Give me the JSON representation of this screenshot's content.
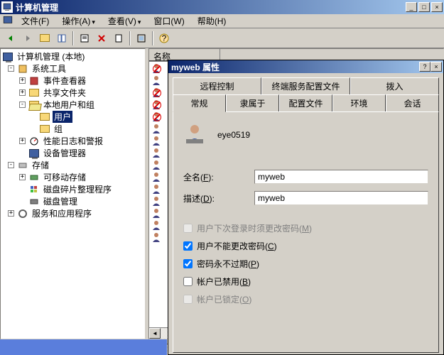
{
  "window": {
    "title": "计算机管理",
    "buttons": {
      "min": "_",
      "max": "□",
      "close": "×"
    }
  },
  "menu": {
    "file": "文件(F)",
    "action": "操作(A)",
    "view": "查看(V)",
    "window": "窗口(W)",
    "help": "帮助(H)"
  },
  "tree": {
    "root": "计算机管理 (本地)",
    "systools": "系统工具",
    "eventviewer": "事件查看器",
    "sharedfolders": "共享文件夹",
    "localusers": "本地用户和组",
    "users": "用户",
    "groups": "组",
    "perflogs": "性能日志和警报",
    "devmgr": "设备管理器",
    "storage": "存储",
    "removable": "可移动存储",
    "defrag": "磁盘碎片整理程序",
    "diskmgr": "磁盘管理",
    "services": "服务和应用程序"
  },
  "list": {
    "col_name": "名称"
  },
  "dialog": {
    "title": "myweb 属性",
    "help": "?",
    "close": "×",
    "tabs": {
      "remote": "远程控制",
      "tsprofile": "终端服务配置文件",
      "dialin": "拨入",
      "general": "常规",
      "memberof": "隶属于",
      "profile": "配置文件",
      "environment": "环境",
      "sessions": "会话"
    },
    "username": "eye0519",
    "fullname_label": "全名(F):",
    "fullname_value": "myweb",
    "desc_label": "描述(D):",
    "desc_value": "myweb",
    "chk_mustchange": "用户下次登录时须更改密码(M)",
    "chk_cannotchange": "用户不能更改密码(C)",
    "chk_neverexpire": "密码永不过期(P)",
    "chk_disabled": "帐户已禁用(B)",
    "chk_locked": "帐户已锁定(O)",
    "checks": {
      "mustchange": false,
      "cannotchange": true,
      "neverexpire": true,
      "disabled": false,
      "locked": false
    }
  }
}
